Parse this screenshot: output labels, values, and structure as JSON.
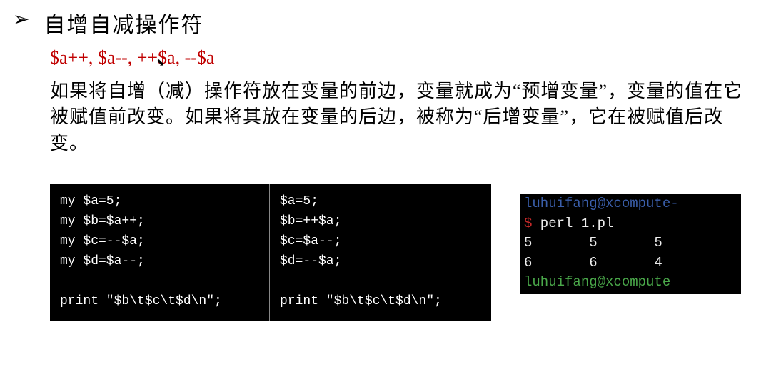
{
  "bullet": "➢",
  "title": "自增自减操作符",
  "operators": "$a++, $a--, ++$a, --$a",
  "description": "如果将自增（减）操作符放在变量的前边，变量就成为“预增变量”，变量的值在它被赋值前改变。如果将其放在变量的后边，被称为“后增变量”，它在被赋值后改变。",
  "code1": "my $a=5;\nmy $b=$a++;\nmy $c=--$a;\nmy $d=$a--;\n\nprint \"$b\\t$c\\t$d\\n\";",
  "code2": "$a=5;\n$b=++$a;\n$c=$a--;\n$d=--$a;\n\nprint \"$b\\t$c\\t$d\\n\";",
  "output": {
    "line1_host": "luhuifang@xcompute-",
    "line2_prompt": "$",
    "line2_cmd": " perl 1.pl",
    "line3": "5       5       5",
    "line4": "6       6       4",
    "line5_host": "luhuifang@xcompute"
  },
  "cursor": "⬊"
}
